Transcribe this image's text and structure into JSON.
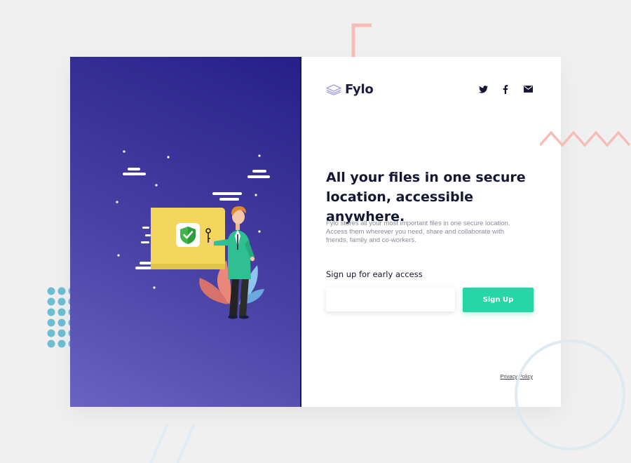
{
  "brand": {
    "name": "Fylo",
    "logo_icon": "stacked-layers-icon",
    "accent_color": "#26d6a4",
    "panel_color": "#3f36a0"
  },
  "social": [
    {
      "name": "twitter",
      "icon": "twitter-icon"
    },
    {
      "name": "facebook",
      "icon": "facebook-icon"
    },
    {
      "name": "email",
      "icon": "envelope-icon"
    }
  ],
  "hero": {
    "headline": "All your files in one secure location, accessible anywhere.",
    "description": "Fylo stores all your most important files in one secure location. Access them wherever you need, share and collaborate with friends, family and co-workers.",
    "illustration": "person-with-secure-folder-illustration"
  },
  "signup": {
    "label": "Sign up for early access",
    "email_value": "",
    "email_placeholder": "",
    "button_label": "Sign Up"
  },
  "footer": {
    "privacy_label": "Privacy Policy"
  }
}
